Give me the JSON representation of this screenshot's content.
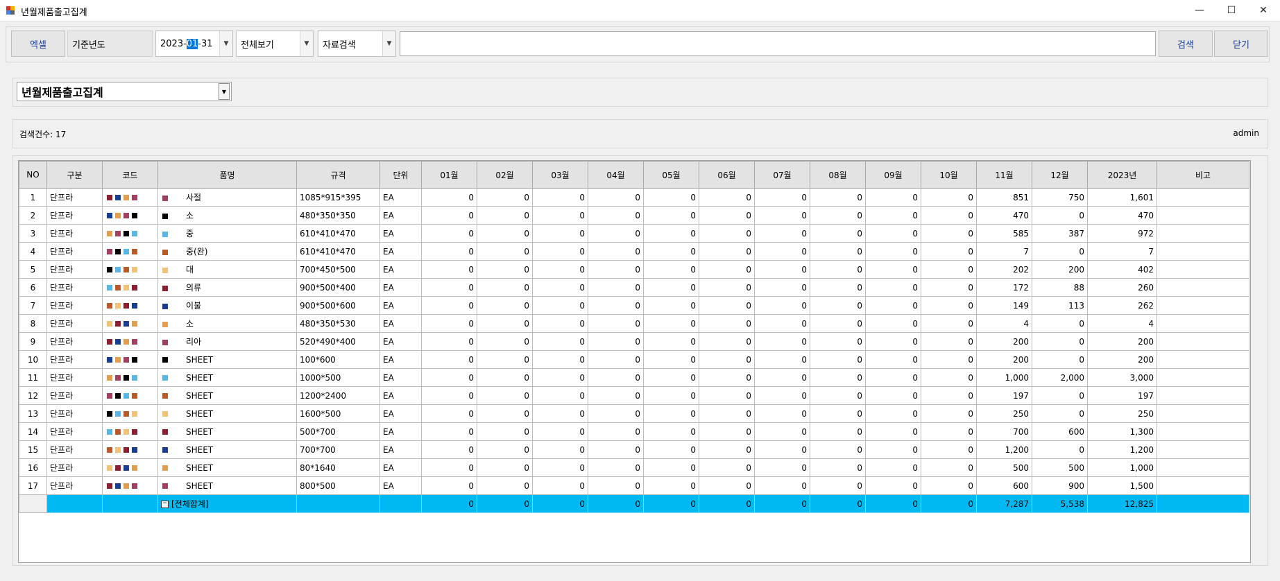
{
  "window": {
    "title": "년월제품출고집계",
    "min_glyph": "—",
    "max_glyph": "☐",
    "close_glyph": "✕"
  },
  "toolbar": {
    "excel_label": "엑셀",
    "base_year_label": "기준년도",
    "date_prefix": "2023-",
    "date_selected": "01",
    "date_suffix": "-31",
    "view_value": "전체보기",
    "search_type_value": "자료검색",
    "search_text": "",
    "search_label": "검색",
    "close_label": "닫기"
  },
  "report": {
    "selected": "년월제품출고집계"
  },
  "status": {
    "count_text": "검색건수: 17",
    "user": "admin"
  },
  "grid": {
    "columns": [
      "NO",
      "구분",
      "코드",
      "품명",
      "규격",
      "단위",
      "01월",
      "02월",
      "03월",
      "04월",
      "05월",
      "06월",
      "07월",
      "08월",
      "09월",
      "10월",
      "11월",
      "12월",
      "2023년",
      "비고"
    ],
    "rows": [
      {
        "no": "1",
        "cat": "단프라",
        "code": "",
        "name": "사절",
        "spec": "1085*915*395",
        "unit": "EA",
        "m": [
          "0",
          "0",
          "0",
          "0",
          "0",
          "0",
          "0",
          "0",
          "0",
          "0",
          "851",
          "750"
        ],
        "total": "1,601",
        "note": ""
      },
      {
        "no": "2",
        "cat": "단프라",
        "code": "",
        "name": "소",
        "spec": "480*350*350",
        "unit": "EA",
        "m": [
          "0",
          "0",
          "0",
          "0",
          "0",
          "0",
          "0",
          "0",
          "0",
          "0",
          "470",
          "0"
        ],
        "total": "470",
        "note": ""
      },
      {
        "no": "3",
        "cat": "단프라",
        "code": "",
        "name": "중",
        "spec": "610*410*470",
        "unit": "EA",
        "m": [
          "0",
          "0",
          "0",
          "0",
          "0",
          "0",
          "0",
          "0",
          "0",
          "0",
          "585",
          "387"
        ],
        "total": "972",
        "note": ""
      },
      {
        "no": "4",
        "cat": "단프라",
        "code": "",
        "name": "중(완)",
        "spec": "610*410*470",
        "unit": "EA",
        "m": [
          "0",
          "0",
          "0",
          "0",
          "0",
          "0",
          "0",
          "0",
          "0",
          "0",
          "7",
          "0"
        ],
        "total": "7",
        "note": ""
      },
      {
        "no": "5",
        "cat": "단프라",
        "code": "",
        "name": "대",
        "spec": "700*450*500",
        "unit": "EA",
        "m": [
          "0",
          "0",
          "0",
          "0",
          "0",
          "0",
          "0",
          "0",
          "0",
          "0",
          "202",
          "200"
        ],
        "total": "402",
        "note": ""
      },
      {
        "no": "6",
        "cat": "단프라",
        "code": "",
        "name": "의류",
        "spec": "900*500*400",
        "unit": "EA",
        "m": [
          "0",
          "0",
          "0",
          "0",
          "0",
          "0",
          "0",
          "0",
          "0",
          "0",
          "172",
          "88"
        ],
        "total": "260",
        "note": ""
      },
      {
        "no": "7",
        "cat": "단프라",
        "code": "",
        "name": "이불",
        "spec": "900*500*600",
        "unit": "EA",
        "m": [
          "0",
          "0",
          "0",
          "0",
          "0",
          "0",
          "0",
          "0",
          "0",
          "0",
          "149",
          "113"
        ],
        "total": "262",
        "note": ""
      },
      {
        "no": "8",
        "cat": "단프라",
        "code": "",
        "name": "소",
        "spec": "480*350*530",
        "unit": "EA",
        "m": [
          "0",
          "0",
          "0",
          "0",
          "0",
          "0",
          "0",
          "0",
          "0",
          "0",
          "4",
          "0"
        ],
        "total": "4",
        "note": ""
      },
      {
        "no": "9",
        "cat": "단프라",
        "code": "",
        "name": "리아",
        "spec": "520*490*400",
        "unit": "EA",
        "m": [
          "0",
          "0",
          "0",
          "0",
          "0",
          "0",
          "0",
          "0",
          "0",
          "0",
          "200",
          "0"
        ],
        "total": "200",
        "note": ""
      },
      {
        "no": "10",
        "cat": "단프라",
        "code": "",
        "name": "SHEET",
        "spec": "100*600",
        "unit": "EA",
        "m": [
          "0",
          "0",
          "0",
          "0",
          "0",
          "0",
          "0",
          "0",
          "0",
          "0",
          "200",
          "0"
        ],
        "total": "200",
        "note": ""
      },
      {
        "no": "11",
        "cat": "단프라",
        "code": "",
        "name": "SHEET",
        "spec": "1000*500",
        "unit": "EA",
        "m": [
          "0",
          "0",
          "0",
          "0",
          "0",
          "0",
          "0",
          "0",
          "0",
          "0",
          "1,000",
          "2,000"
        ],
        "total": "3,000",
        "note": ""
      },
      {
        "no": "12",
        "cat": "단프라",
        "code": "",
        "name": "SHEET",
        "spec": "1200*2400",
        "unit": "EA",
        "m": [
          "0",
          "0",
          "0",
          "0",
          "0",
          "0",
          "0",
          "0",
          "0",
          "0",
          "197",
          "0"
        ],
        "total": "197",
        "note": ""
      },
      {
        "no": "13",
        "cat": "단프라",
        "code": "",
        "name": "SHEET",
        "spec": "1600*500",
        "unit": "EA",
        "m": [
          "0",
          "0",
          "0",
          "0",
          "0",
          "0",
          "0",
          "0",
          "0",
          "0",
          "250",
          "0"
        ],
        "total": "250",
        "note": ""
      },
      {
        "no": "14",
        "cat": "단프라",
        "code": "",
        "name": "SHEET",
        "spec": "500*700",
        "unit": "EA",
        "m": [
          "0",
          "0",
          "0",
          "0",
          "0",
          "0",
          "0",
          "0",
          "0",
          "0",
          "700",
          "600"
        ],
        "total": "1,300",
        "note": ""
      },
      {
        "no": "15",
        "cat": "단프라",
        "code": "",
        "name": "SHEET",
        "spec": "700*700",
        "unit": "EA",
        "m": [
          "0",
          "0",
          "0",
          "0",
          "0",
          "0",
          "0",
          "0",
          "0",
          "0",
          "1,200",
          "0"
        ],
        "total": "1,200",
        "note": ""
      },
      {
        "no": "16",
        "cat": "단프라",
        "code": "",
        "name": "SHEET",
        "spec": "80*1640",
        "unit": "EA",
        "m": [
          "0",
          "0",
          "0",
          "0",
          "0",
          "0",
          "0",
          "0",
          "0",
          "0",
          "500",
          "500"
        ],
        "total": "1,000",
        "note": ""
      },
      {
        "no": "17",
        "cat": "단프라",
        "code": "",
        "name": "SHEET",
        "spec": "800*500",
        "unit": "EA",
        "m": [
          "0",
          "0",
          "0",
          "0",
          "0",
          "0",
          "0",
          "0",
          "0",
          "0",
          "600",
          "900"
        ],
        "total": "1,500",
        "note": ""
      }
    ],
    "total_row": {
      "label": "[전체합계]",
      "m": [
        "0",
        "0",
        "0",
        "0",
        "0",
        "0",
        "0",
        "0",
        "0",
        "0",
        "7,287",
        "5,538"
      ],
      "total": "12,825"
    }
  },
  "colors": {
    "total_row_bg": "#00b9f2",
    "header_bg": "#e3e3e3",
    "accent": "#0078d7"
  }
}
